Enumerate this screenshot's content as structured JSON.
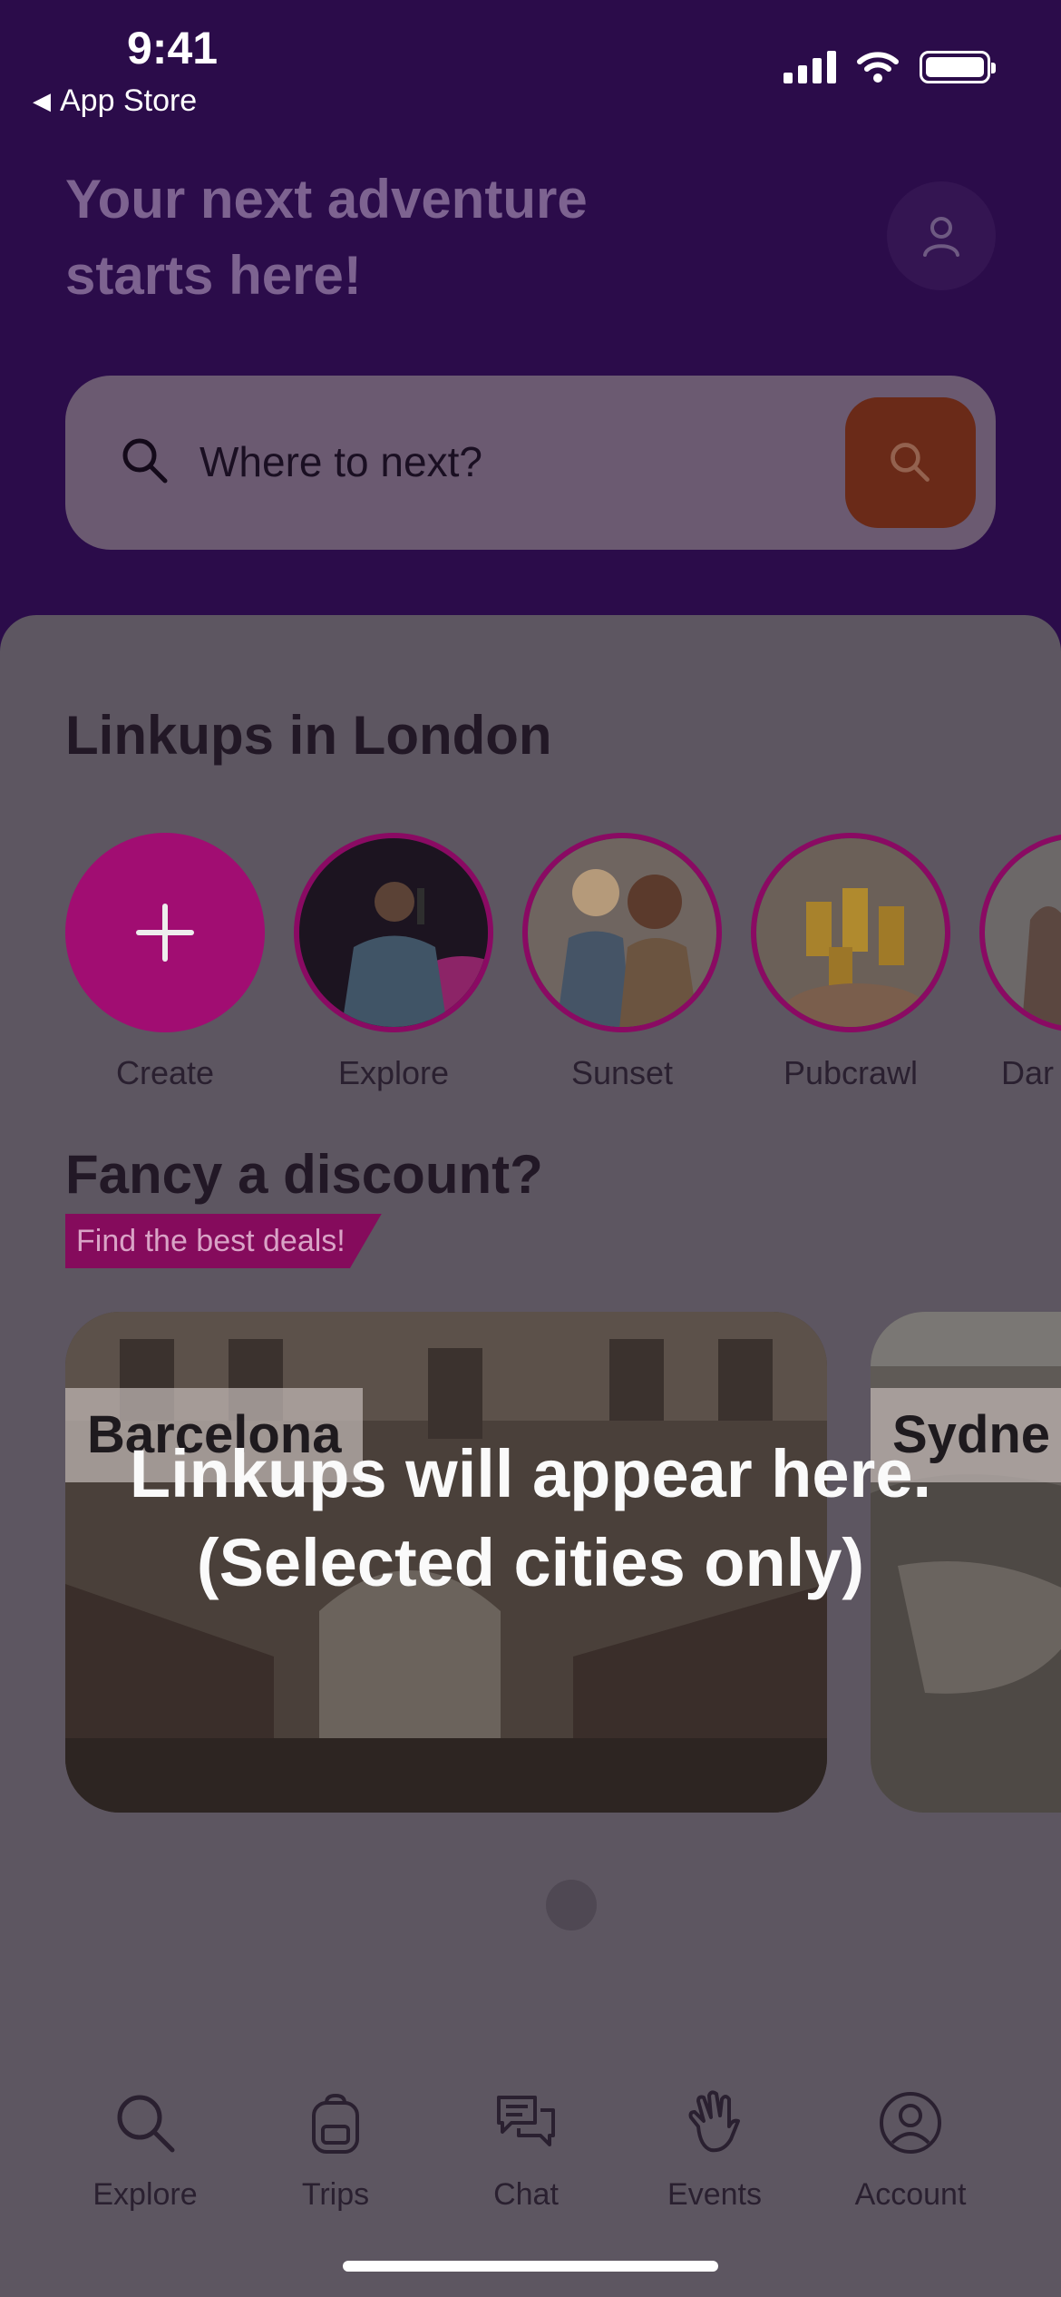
{
  "status_bar": {
    "time": "9:41",
    "back_label": "App Store"
  },
  "header": {
    "title_line1": "Your next adventure",
    "title_line2": "starts here!",
    "search_placeholder": "Where to next?"
  },
  "linkups": {
    "title": "Linkups in London",
    "stories": [
      {
        "label": "Create"
      },
      {
        "label": "Explore"
      },
      {
        "label": "Sunset"
      },
      {
        "label": "Pubcrawl"
      },
      {
        "label": "Dar"
      }
    ]
  },
  "discount": {
    "title": "Fancy a discount?",
    "tag": "Find the best deals!",
    "cities": [
      {
        "name": "Barcelona"
      },
      {
        "name": "Sydne"
      }
    ]
  },
  "overlay": {
    "line1": "Linkups will appear here.",
    "line2": "(Selected cities only)"
  },
  "tabbar": {
    "items": [
      {
        "label": "Explore",
        "icon": "search-icon"
      },
      {
        "label": "Trips",
        "icon": "backpack-icon"
      },
      {
        "label": "Chat",
        "icon": "chat-bubbles-icon"
      },
      {
        "label": "Events",
        "icon": "waving-hand-icon"
      },
      {
        "label": "Account",
        "icon": "account-icon"
      }
    ]
  },
  "colors": {
    "header_bg": "#2b0c4a",
    "sheet_bg": "#5d5661",
    "accent_magenta": "#a10d72",
    "search_button": "#6a2a18"
  }
}
